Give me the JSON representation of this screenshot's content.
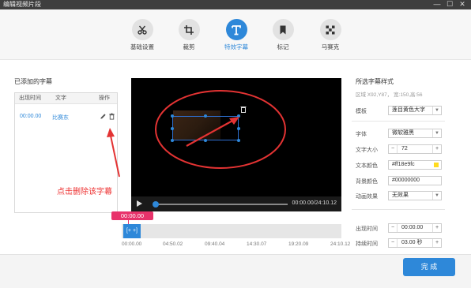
{
  "window": {
    "title": "编辑视频片段",
    "controls": [
      "—",
      "☐",
      "✕"
    ]
  },
  "tabs": [
    {
      "label": "基础设置",
      "icon": "scissors-icon",
      "active": false
    },
    {
      "label": "裁剪",
      "icon": "crop-icon",
      "active": false
    },
    {
      "label": "特效字幕",
      "icon": "text-t-icon",
      "active": true
    },
    {
      "label": "标记",
      "icon": "bookmark-icon",
      "active": false
    },
    {
      "label": "马赛克",
      "icon": "mosaic-icon",
      "active": false
    }
  ],
  "left_panel": {
    "title": "已添加的字幕",
    "columns": [
      "出现时间",
      "文字",
      "操作"
    ],
    "rows": [
      {
        "time": "00:00.00",
        "text": "比赛东"
      }
    ]
  },
  "player": {
    "timecode": "00:00.00/24:10.12"
  },
  "timeline": {
    "marker": "00:00.00",
    "clip_label": "[+ +]",
    "ticks": [
      "00:00.00",
      "04:50.02",
      "09:40.04",
      "14:30.07",
      "19:20.09",
      "24:10.12"
    ]
  },
  "right_panel": {
    "title": "所选字幕样式",
    "subtitle": "区域 X92,Y87，  宽:150,高:56",
    "template": {
      "label": "模板",
      "value": "莲目黄色大字"
    },
    "font": {
      "label": "字体",
      "value": "微软雅黑"
    },
    "font_size": {
      "label": "文字大小",
      "value": "72"
    },
    "text_color": {
      "label": "文本颜色",
      "value": "#ff18e9fc",
      "swatch": "#ffdb1e"
    },
    "bg_color": {
      "label": "背景颜色",
      "value": "#00000000"
    },
    "animation": {
      "label": "动画效果",
      "value": "无效果"
    },
    "start_time": {
      "label": "出现时间",
      "value": "00:00.00"
    },
    "duration": {
      "label": "持续时间",
      "value": "03.00 秒"
    }
  },
  "annotation": {
    "text": "点击删除该字幕",
    "color": "#e33333"
  },
  "footer": {
    "ok_label": "完 成"
  },
  "colors": {
    "accent": "#2e88d9",
    "marker": "#e8336b"
  }
}
